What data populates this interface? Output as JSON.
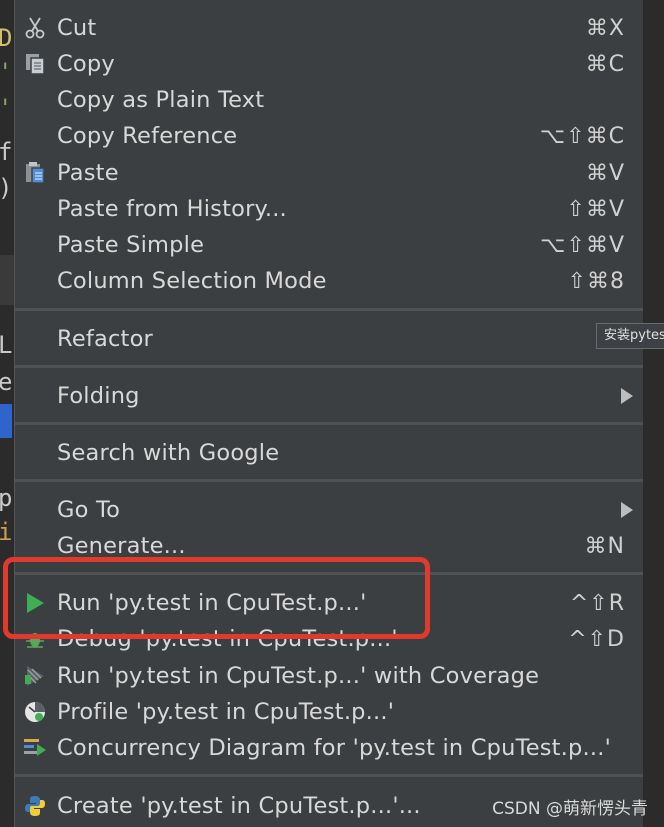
{
  "menu": {
    "items": [
      {
        "label": "Cut",
        "shortcut": "⌘X",
        "icon": "scissors-icon"
      },
      {
        "label": "Copy",
        "shortcut": "⌘C",
        "icon": "copy-icon"
      },
      {
        "label": "Copy as Plain Text",
        "shortcut": ""
      },
      {
        "label": "Copy Reference",
        "shortcut": "⌥⇧⌘C"
      },
      {
        "label": "Paste",
        "shortcut": "⌘V",
        "icon": "paste-icon"
      },
      {
        "label": "Paste from History...",
        "shortcut": "⇧⌘V"
      },
      {
        "label": "Paste Simple",
        "shortcut": "⌥⇧⌘V"
      },
      {
        "label": "Column Selection Mode",
        "shortcut": "⇧⌘8"
      },
      {
        "label": "Refactor",
        "shortcut": ""
      },
      {
        "label": "Folding",
        "shortcut": "",
        "submenu": true
      },
      {
        "label": "Search with Google",
        "shortcut": ""
      },
      {
        "label": "Go To",
        "shortcut": "",
        "submenu": true
      },
      {
        "label": "Generate...",
        "shortcut": "⌘N"
      },
      {
        "label": "Run 'py.test in CpuTest.p...'",
        "shortcut": "^⇧R",
        "icon": "run-icon"
      },
      {
        "label": "Debug 'py.test in CpuTest.p...'",
        "shortcut": "^⇧D",
        "icon": "debug-icon"
      },
      {
        "label": "Run 'py.test in CpuTest.p...' with Coverage",
        "shortcut": "",
        "icon": "coverage-icon"
      },
      {
        "label": "Profile 'py.test in CpuTest.p...'",
        "shortcut": "",
        "icon": "profile-icon"
      },
      {
        "label": "Concurrency Diagram for 'py.test in CpuTest.p...'",
        "shortcut": "",
        "icon": "concurrency-icon"
      },
      {
        "label": "Create 'py.test in CpuTest.p...'...",
        "shortcut": "",
        "icon": "python-icon"
      }
    ]
  },
  "tooltip": {
    "text": "安装pytest"
  },
  "watermark": {
    "text": "CSDN @萌新愣头青"
  },
  "editor": {
    "glyphs": [
      "D",
      "'",
      "'",
      "f",
      ")",
      "L",
      "e",
      "p",
      "i"
    ]
  },
  "colors": {
    "menu_bg": "#3c3f41",
    "highlight": "#e03a2f",
    "run_green": "#3fae52"
  }
}
